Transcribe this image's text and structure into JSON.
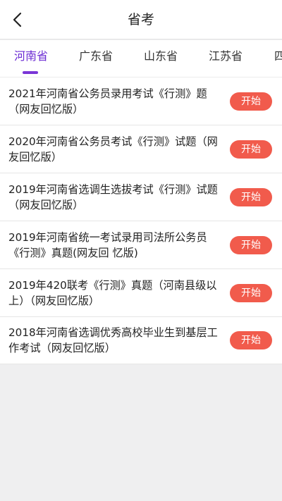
{
  "header": {
    "title": "省考",
    "back_icon": "chevron-left-icon"
  },
  "tabs": [
    {
      "label": "河南省",
      "active": true
    },
    {
      "label": "广东省",
      "active": false
    },
    {
      "label": "山东省",
      "active": false
    },
    {
      "label": "江苏省",
      "active": false
    },
    {
      "label": "四",
      "active": false
    }
  ],
  "items": [
    {
      "title": "2021年河南省公务员录用考试《行测》题（网友回忆版）",
      "button": "开始"
    },
    {
      "title": "2020年河南省公务员考试《行测》试题（网友回忆版）",
      "button": "开始"
    },
    {
      "title": "2019年河南省选调生选拔考试《行测》试题（网友回忆版）",
      "button": "开始"
    },
    {
      "title": "2019年河南省统一考试录用司法所公务员《行测》真题(网友回 忆版)",
      "button": "开始"
    },
    {
      "title": "2019年420联考《行测》真题（河南县级以上）（网友回忆版）",
      "button": "开始"
    },
    {
      "title": "2018年河南省选调优秀高校毕业生到基层工作考试（网友回忆版）",
      "button": "开始"
    }
  ],
  "colors": {
    "accent": "#7a35d6",
    "button": "#f15b4c",
    "background": "#efeff0"
  }
}
